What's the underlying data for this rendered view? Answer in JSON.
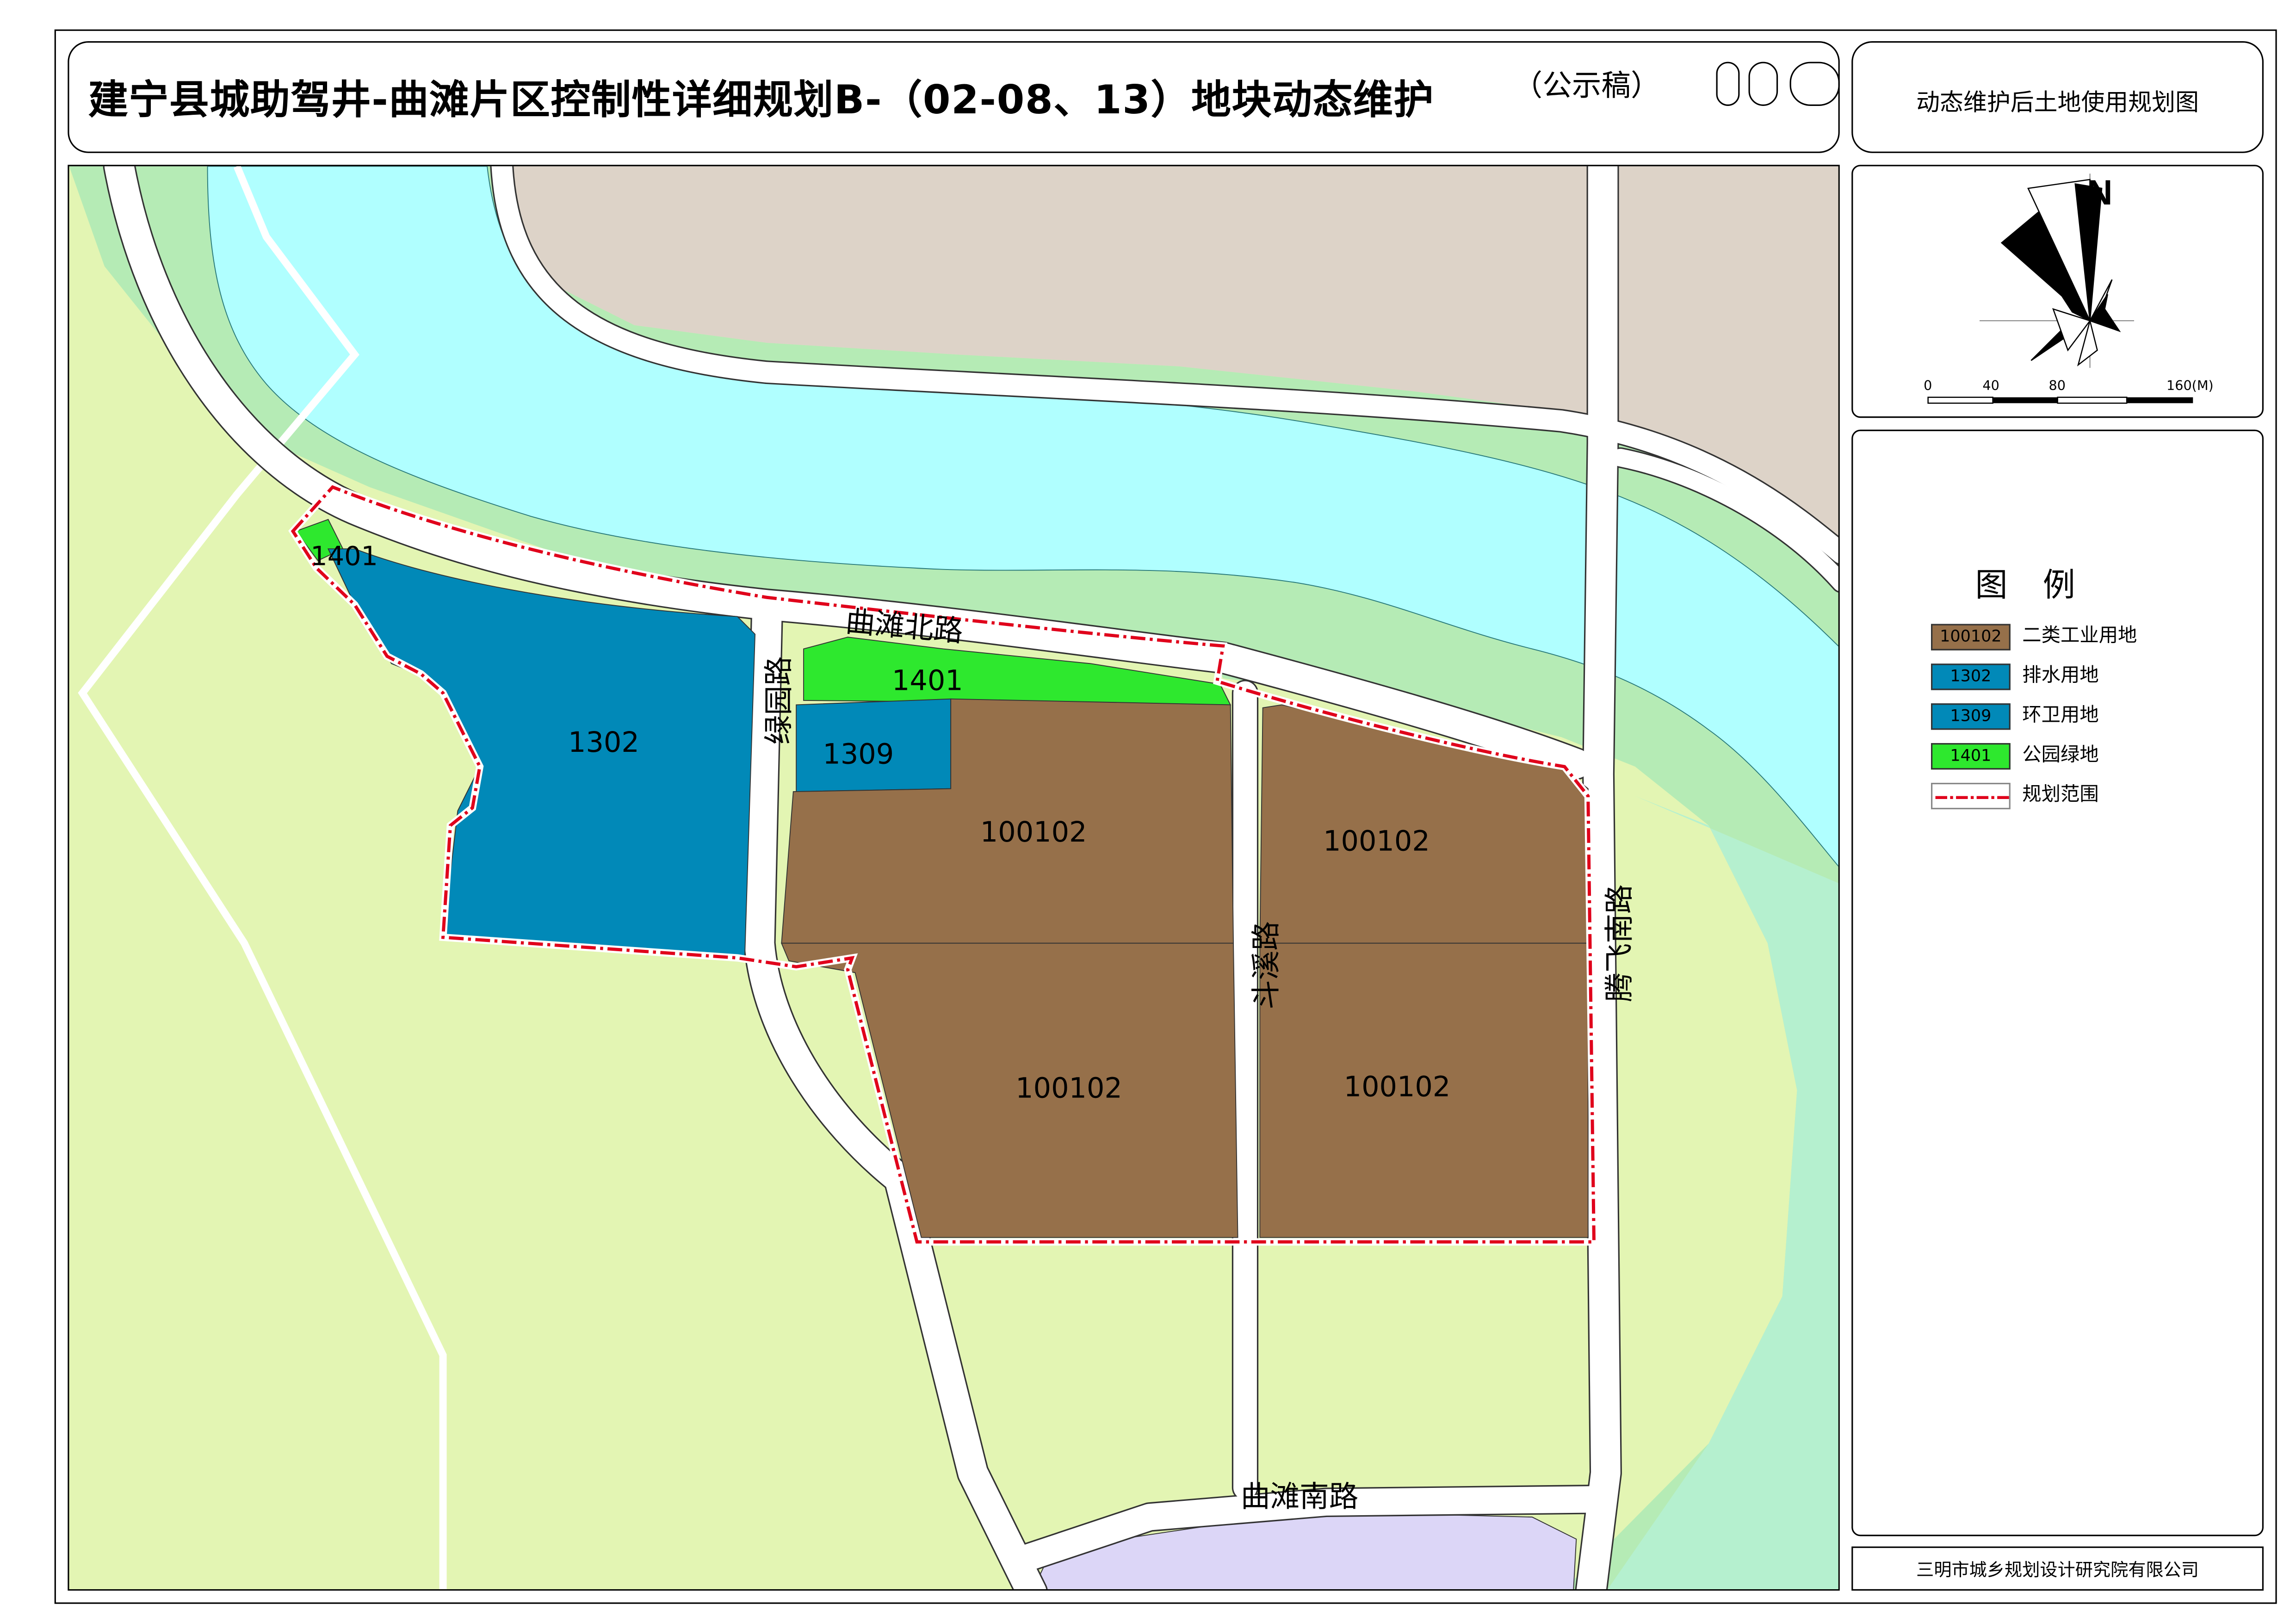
{
  "title": {
    "main": "建宁县城助驾井-曲滩片区控制性详细规划B-（02-08、13）地块动态维护",
    "status": "（公示稿）",
    "drawing_name": "动态维护后土地使用规划图"
  },
  "map": {
    "parcels": [
      {
        "code": "1401",
        "use": "公园绿地"
      },
      {
        "code": "1302",
        "use": "排水用地"
      },
      {
        "code": "1401",
        "use": "公园绿地"
      },
      {
        "code": "1309",
        "use": "环卫用地"
      },
      {
        "code": "100102",
        "use": "二类工业用地"
      },
      {
        "code": "100102",
        "use": "二类工业用地"
      },
      {
        "code": "100102",
        "use": "二类工业用地"
      },
      {
        "code": "100102",
        "use": "二类工业用地"
      }
    ],
    "roads": [
      "曲滩北路",
      "绿园路",
      "斗溪路",
      "腾飞南路",
      "曲滩南路"
    ]
  },
  "compass": {
    "north_label": "N",
    "scale_ticks": [
      "0",
      "40",
      "80",
      "160(M)"
    ]
  },
  "legend": {
    "title": "图例",
    "items": [
      {
        "swatch_text": "100102",
        "label": "二类工业用地",
        "color": "#96704a"
      },
      {
        "swatch_text": "1302",
        "label": "排水用地",
        "color": "#0189b8"
      },
      {
        "swatch_text": "1309",
        "label": "环卫用地",
        "color": "#0189b8"
      },
      {
        "swatch_text": "1401",
        "label": "公园绿地",
        "color": "#2ee82e"
      },
      {
        "swatch_text": "",
        "label": "规划范围",
        "color": "#e0001b"
      }
    ]
  },
  "organization": "三明市城乡规划设计研究院有限公司",
  "colors": {
    "river": "#b0ffff",
    "riverbank_green": "#b5ebb5",
    "farmland": "#e3f5b3",
    "mountain_beige": "#ddd3c8",
    "industrial_brown": "#96704a",
    "drainage_blue": "#0189b8",
    "park_green": "#2ee82e",
    "purple_area": "#dcd6f7",
    "boundary_red": "#e0001b"
  }
}
